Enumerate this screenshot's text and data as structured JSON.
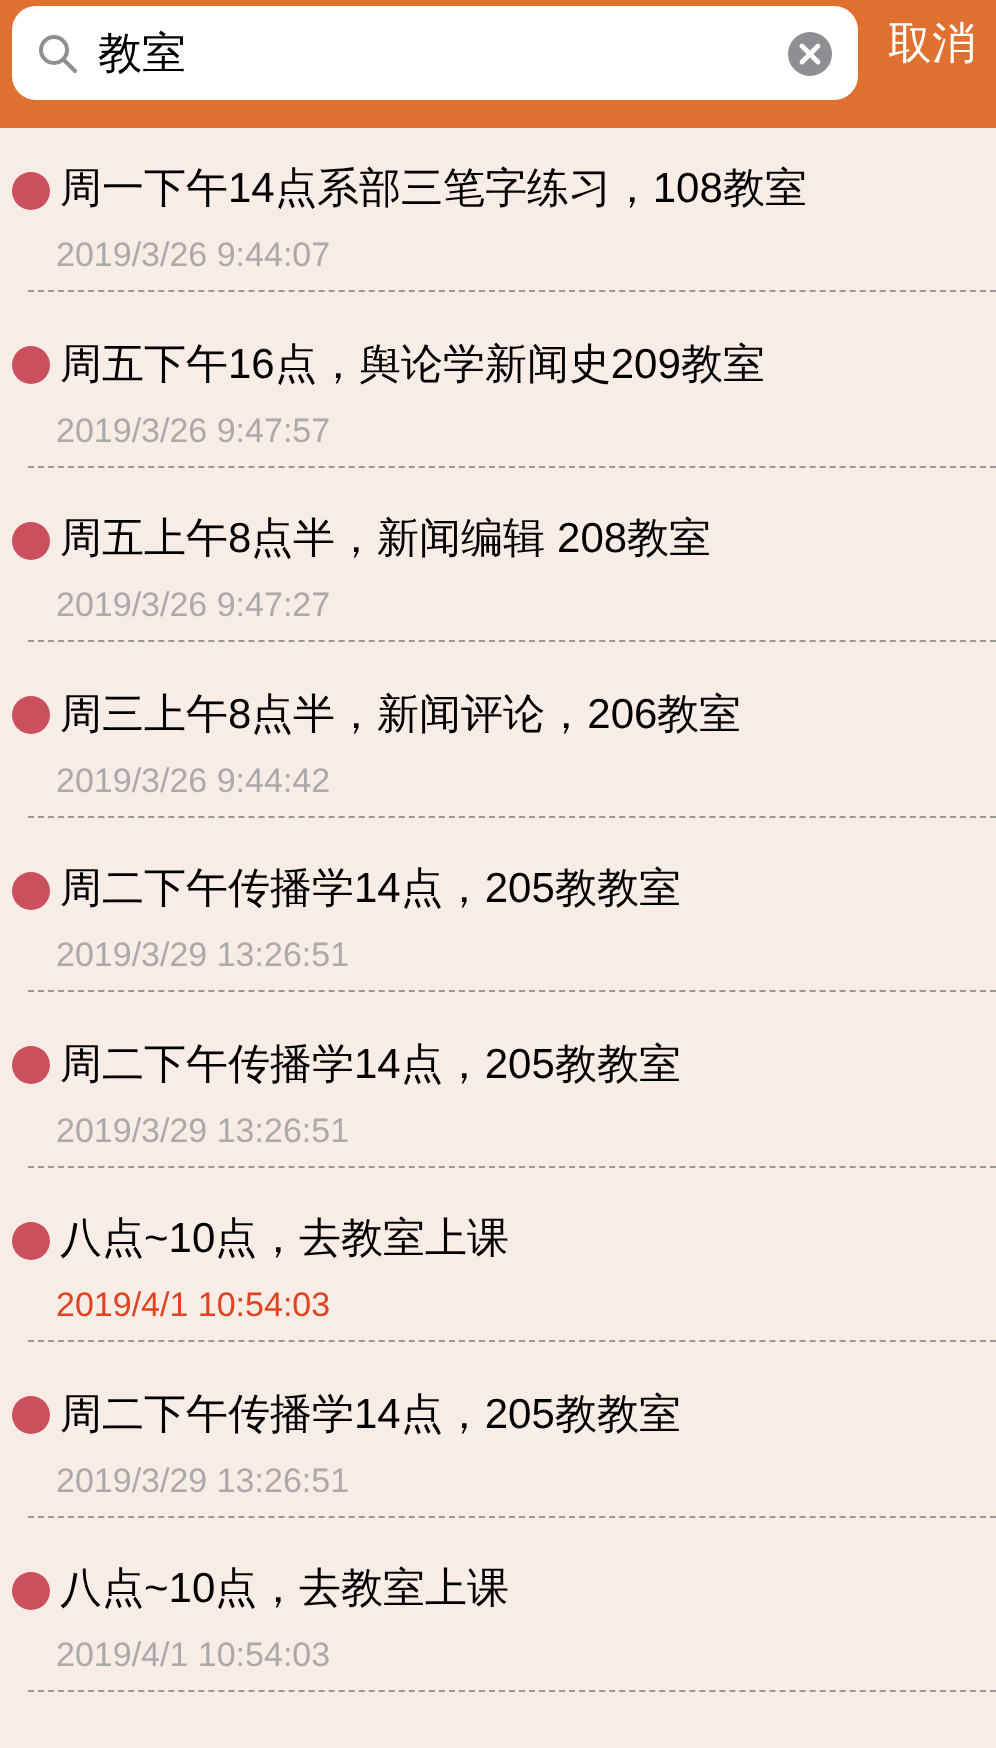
{
  "search": {
    "value": "教室",
    "cancel": "取消"
  },
  "results": [
    {
      "title": "周一下午14点系部三笔字练习，108教室",
      "time": "2019/3/26 9:44:07",
      "highlighted": false
    },
    {
      "title": "周五下午16点，舆论学新闻史209教室",
      "time": "2019/3/26 9:47:57",
      "highlighted": false
    },
    {
      "title": "周五上午8点半，新闻编辑 208教室",
      "time": "2019/3/26 9:47:27",
      "highlighted": false
    },
    {
      "title": "周三上午8点半，新闻评论，206教室",
      "time": "2019/3/26 9:44:42",
      "highlighted": false
    },
    {
      "title": "周二下午传播学14点，205教教室",
      "time": "2019/3/29 13:26:51",
      "highlighted": false
    },
    {
      "title": "周二下午传播学14点，205教教室",
      "time": "2019/3/29 13:26:51",
      "highlighted": false
    },
    {
      "title": "八点~10点，去教室上课",
      "time": "2019/4/1 10:54:03",
      "highlighted": true
    },
    {
      "title": "周二下午传播学14点，205教教室",
      "time": "2019/3/29 13:26:51",
      "highlighted": false
    },
    {
      "title": "八点~10点，去教室上课",
      "time": "2019/4/1 10:54:03",
      "highlighted": false
    }
  ]
}
